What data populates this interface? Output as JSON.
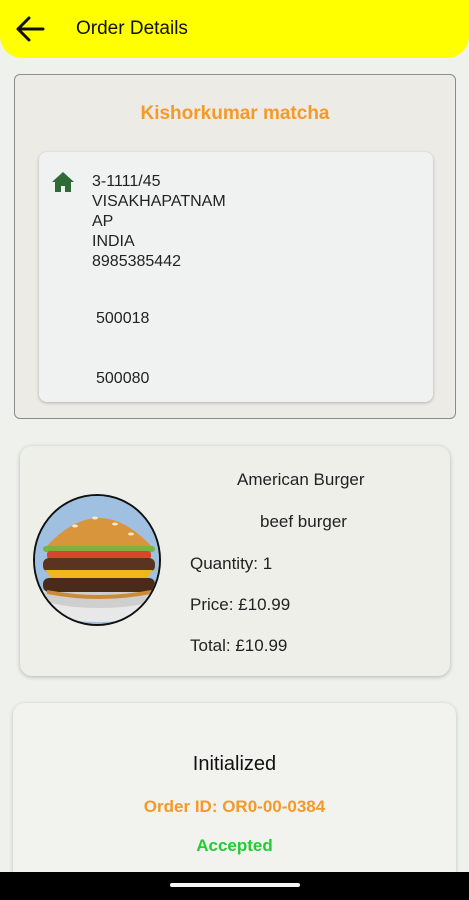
{
  "appbar": {
    "title": "Order Details",
    "back_icon": "arrow-left-icon",
    "color": "#ffff00"
  },
  "address": {
    "customer_name": "Kishorkumar matcha",
    "icon": "home-icon",
    "lines": [
      "3-1111/45",
      "VISAKHAPATNAM",
      "AP",
      "INDIA",
      "8985385442"
    ],
    "pincodes": [
      "500018",
      "500080"
    ]
  },
  "item": {
    "name": "American Burger",
    "description": "beef burger",
    "quantity": "Quantity: 1",
    "price": "Price: £10.99",
    "total": "Total: £10.99"
  },
  "status": {
    "title": "Initialized",
    "order_id": "Order ID: OR0-00-0384",
    "state": "Accepted",
    "accent_color": "#f39a2a",
    "state_color": "#22cc33"
  }
}
